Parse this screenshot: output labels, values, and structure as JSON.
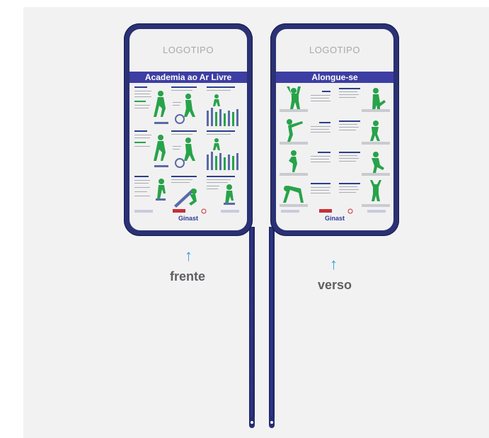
{
  "front": {
    "logo_text": "LOGOTIPO",
    "title": "Academia ao Ar Livre",
    "brand": "Ginast",
    "caption": "frente"
  },
  "back": {
    "logo_text": "LOGOTIPO",
    "title": "Alongue-se",
    "brand": "Ginast",
    "caption": "verso"
  },
  "colors": {
    "frame": "#2a3174",
    "title_band": "#3d3ea3",
    "figure_green": "#27a34a",
    "arrow": "#2aa1e0"
  },
  "icons": {
    "arrow": "arrow-up-icon"
  }
}
